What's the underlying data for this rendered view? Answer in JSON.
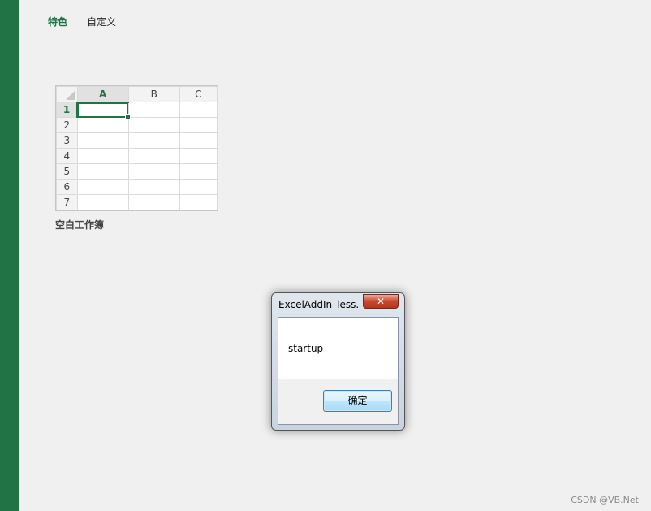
{
  "colors": {
    "accent": "#217346",
    "background": "#f0f0f0"
  },
  "tabs": [
    {
      "label": "特色",
      "active": true
    },
    {
      "label": "自定义",
      "active": false
    }
  ],
  "template": {
    "label": "空白工作簿",
    "columns": [
      "A",
      "B",
      "C"
    ],
    "rows": [
      "1",
      "2",
      "3",
      "4",
      "5",
      "6",
      "7"
    ],
    "selected_cell": "A1"
  },
  "dialog": {
    "title": "ExcelAddIn_less...",
    "close_icon": "close-icon",
    "message": "startup",
    "ok_label": "确定"
  },
  "watermark": "CSDN @VB.Net"
}
